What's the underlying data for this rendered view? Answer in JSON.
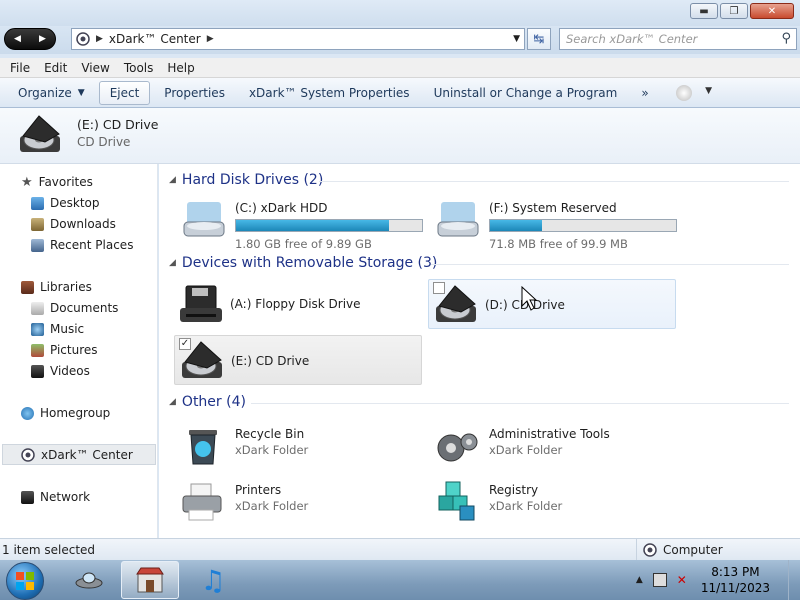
{
  "window": {
    "minimize_glyph": "▬",
    "maximize_glyph": "❐",
    "close_glyph": "✕"
  },
  "address": {
    "path": "xDark™ Center",
    "search_placeholder": "Search xDark™ Center"
  },
  "menu": [
    "File",
    "Edit",
    "View",
    "Tools",
    "Help"
  ],
  "toolbar": {
    "organize": "Organize",
    "eject": "Eject",
    "properties": "Properties",
    "system_properties": "xDark™ System Properties",
    "uninstall": "Uninstall or Change a Program",
    "more": "»"
  },
  "details": {
    "title": "(E:) CD Drive",
    "subtitle": "CD Drive"
  },
  "sidebar": {
    "favorites": "Favorites",
    "desktop": "Desktop",
    "downloads": "Downloads",
    "recent": "Recent Places",
    "libraries": "Libraries",
    "documents": "Documents",
    "music": "Music",
    "pictures": "Pictures",
    "videos": "Videos",
    "homegroup": "Homegroup",
    "xdark_center": "xDark™ Center",
    "network": "Network"
  },
  "groups": {
    "hdd": "Hard Disk Drives (2)",
    "removable": "Devices with Removable Storage (3)",
    "other": "Other (4)"
  },
  "drives": {
    "c": {
      "name": "(C:) xDark HDD",
      "free": "1.80 GB free of 9.89 GB",
      "used_fraction": 0.82
    },
    "f": {
      "name": "(F:) System Reserved",
      "free": "71.8 MB free of 99.9 MB",
      "used_fraction": 0.28
    }
  },
  "removable": {
    "a": "(A:) Floppy Disk Drive",
    "d": "(D:) CD Drive",
    "e": "(E:) CD Drive"
  },
  "other": {
    "recycle": {
      "name": "Recycle Bin",
      "type": "xDark Folder"
    },
    "admin": {
      "name": "Administrative Tools",
      "type": "xDark Folder"
    },
    "printers": {
      "name": "Printers",
      "type": "xDark Folder"
    },
    "registry": {
      "name": "Registry",
      "type": "xDark Folder"
    }
  },
  "status": {
    "selection": "1 item selected",
    "location": "Computer"
  },
  "clock": {
    "time": "8:13 PM",
    "date": "11/11/2023"
  },
  "colors": {
    "accent": "#1c87b8",
    "group_header": "#1e3287"
  }
}
